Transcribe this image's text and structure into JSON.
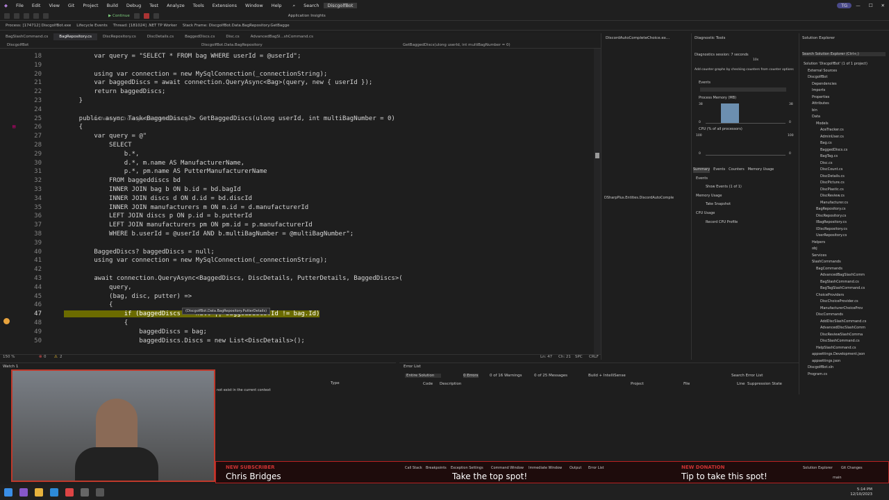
{
  "menu": {
    "items": [
      "File",
      "Edit",
      "View",
      "Git",
      "Project",
      "Build",
      "Debug",
      "Test",
      "Analyze",
      "Tools",
      "Extensions",
      "Window",
      "Help"
    ],
    "search": "Search",
    "app_title": "DiscgolfBot",
    "initials": "TG"
  },
  "toolbar": {
    "process": "Process: [174712] DiscgolfBot.exe",
    "lifecycle": "Lifecycle Events",
    "thread": "Thread: [181024] .NET TP Worker",
    "stack": "Stack Frame: DiscgolfBot.Data.BagRepository.GetBagge",
    "continue": "Continue",
    "insights": "Application Insights"
  },
  "tabs": [
    "BagSlashCommand.cs",
    "BagRepository.cs",
    "DiscRepository.cs",
    "DiscDetails.cs",
    "BaggedDiscs.cs",
    "Disc.cs",
    "AdvancedBagSl...shCommand.cs"
  ],
  "nav": {
    "project": "DiscgolfBot",
    "class": "DiscgolfBot.Data.BagRepository",
    "method": "GetBaggedDiscs(ulong userId, int multiBagNumber = 0)"
  },
  "editor": {
    "lines": [
      {
        "n": "18",
        "t": "        var query = \"SELECT * FROM bag WHERE userId = @userId\";"
      },
      {
        "n": "19",
        "t": ""
      },
      {
        "n": "20",
        "t": "        using var connection = new MySqlConnection(_connectionString);"
      },
      {
        "n": "21",
        "t": "        var baggedDiscs = await connection.QueryAsync<Bag>(query, new { userId });"
      },
      {
        "n": "22",
        "t": "        return baggedDiscs;"
      },
      {
        "n": "23",
        "t": "    }"
      },
      {
        "n": "24",
        "t": ""
      },
      {
        "n": "25",
        "t": "    public async Task<BaggedDiscs?> GetBaggedDiscs(ulong userId, int multiBagNumber = 0)"
      },
      {
        "n": "26",
        "t": "    {"
      },
      {
        "n": "27",
        "t": "        var query = @\""
      },
      {
        "n": "28",
        "t": "            SELECT"
      },
      {
        "n": "29",
        "t": "                b.*,"
      },
      {
        "n": "30",
        "t": "                d.*, m.name AS ManufacturerName,"
      },
      {
        "n": "31",
        "t": "                p.*, pm.name AS PutterManufacturerName"
      },
      {
        "n": "32",
        "t": "            FROM baggeddiscs bd"
      },
      {
        "n": "33",
        "t": "            INNER JOIN bag b ON b.id = bd.bagId"
      },
      {
        "n": "34",
        "t": "            INNER JOIN discs d ON d.id = bd.discId"
      },
      {
        "n": "35",
        "t": "            INNER JOIN manufacturers m ON m.id = d.manufacturerId"
      },
      {
        "n": "36",
        "t": "            LEFT JOIN discs p ON p.id = b.putterId"
      },
      {
        "n": "37",
        "t": "            LEFT JOIN manufacturers pm ON pm.id = p.manufacturerId"
      },
      {
        "n": "38",
        "t": "            WHERE b.userId = @userId AND b.multiBagNumber = @multiBagNumber\";"
      },
      {
        "n": "39",
        "t": ""
      },
      {
        "n": "40",
        "t": "        BaggedDiscs? baggedDiscs = null;"
      },
      {
        "n": "41",
        "t": "        using var connection = new MySqlConnection(_connectionString);"
      },
      {
        "n": "42",
        "t": ""
      },
      {
        "n": "43",
        "t": "        await connection.QueryAsync<BaggedDiscs, DiscDetails, PutterDetails, BaggedDiscs>("
      },
      {
        "n": "44",
        "t": "            query,"
      },
      {
        "n": "45",
        "t": "            (bag, disc, putter) =>"
      },
      {
        "n": "46",
        "t": "            {"
      },
      {
        "n": "47",
        "t": "                if (baggedDiscs == null || baggedDiscs.Id != bag.Id)"
      },
      {
        "n": "48",
        "t": "                {"
      },
      {
        "n": "49",
        "t": "                    baggedDiscs = bag;"
      },
      {
        "n": "50",
        "t": "                    baggedDiscs.Discs = new List<DiscDetails>();"
      }
    ],
    "codelens": "4 references | 0 changes | 0 authors, 0 changes",
    "tooltip": "(DiscgolfBot.Data.BagRepository.PutterDetails)"
  },
  "status": {
    "zoom": "150 %",
    "errors": "0",
    "warnings": "2",
    "ln": "Ln: 47",
    "ch": "Ch: 21",
    "spc": "SPC",
    "crlf": "CRLF"
  },
  "minipanel": {
    "title": "DiscordAutoCompleteChoice.ex...",
    "label": "DSharpPlus.Entities.DiscordAutoComple"
  },
  "diagnostics": {
    "title": "Diagnostic Tools",
    "session": "Diagnostics session: 7 seconds",
    "hint": "Add counter graphs by checking counters from counter options",
    "events": "Events",
    "process_memory": "Process Memory (MB)",
    "cpu": "CPU (% of all processors)",
    "mem_max": "38",
    "mem_min": "0",
    "cpu_max": "100",
    "cpu_min": "0",
    "tabs": [
      "Summary",
      "Events",
      "Counters",
      "Memory Usage"
    ],
    "events_h": "Events",
    "show_events": "Show Events (1 of 1)",
    "memory_usage": "Memory Usage",
    "snapshot": "Take Snapshot",
    "cpu_usage": "CPU Usage",
    "record": "Record CPU Profile",
    "tick": "10s"
  },
  "solution": {
    "title": "Solution Explorer",
    "search": "Search Solution Explorer (Ctrl+;)",
    "items": [
      "Solution 'DiscgolfBot' (1 of 1 project)",
      "External Sources",
      "DiscgolfBot",
      "Dependencies",
      "Imports",
      "Properties",
      "Attributes",
      "bin",
      "Data",
      "Models",
      "AceTracker.cs",
      "AdminUser.cs",
      "Bag.cs",
      "BaggedDiscs.cs",
      "BagTag.cs",
      "Disc.cs",
      "DiscCount.cs",
      "DiscDetails.cs",
      "DiscPicture.cs",
      "DiscPlastic.cs",
      "DiscReview.cs",
      "Manufacturer.cs",
      "BagRepository.cs",
      "DiscRepository.cs",
      "IBagRepository.cs",
      "IDiscRepository.cs",
      "UserRepository.cs",
      "Helpers",
      "obj",
      "Services",
      "SlashCommands",
      "BagCommands",
      "AdvancedBagSlashComm",
      "BagSlashCommand.cs",
      "BagTagSlashCommand.cs",
      "ChoiceProviders",
      "DiscChoiceProvider.cs",
      "ManufacturerChoiceProv",
      "DiscCommands",
      "AddDiscSlashCommand.cs",
      "AdvancedDiscSlashComm",
      "DiscReviewSlashComma",
      "DiscSlashCommand.cs",
      "HelpSlashCommand.cs",
      "appsettings.Development.json",
      "appsettings.json",
      "DiscgolfBot.sln",
      "Program.cs"
    ]
  },
  "watch": {
    "title": "Watch 1",
    "type": "Type",
    "msg": "not exist in the current context"
  },
  "errorlist": {
    "title": "Error List",
    "scope": "Entire Solution",
    "errors": "0 Errors",
    "warnings": "0 of 16 Warnings",
    "messages": "0 of 25 Messages",
    "build": "Build + IntelliSense",
    "cols": [
      "Code",
      "Description",
      "Project",
      "File",
      "Line",
      "Suppression State"
    ],
    "search": "Search Error List"
  },
  "bottom_tabs": [
    "Call Stack",
    "Breakpoints",
    "Exception Settings",
    "Command Window",
    "Immediate Window",
    "Output",
    "Error List"
  ],
  "alerts": {
    "sub_label": "NEW SUBSCRIBER",
    "subscriber": "Chris Bridges",
    "top": "Take the top spot!",
    "don_label": "NEW DONATION",
    "donation": "Tip to take this spot!"
  },
  "taskbar": {
    "time": "5:14 PM",
    "date": "12/10/2023",
    "branch": "main",
    "sol_tab": "Solution Explorer",
    "git_tab": "Git Changes"
  }
}
